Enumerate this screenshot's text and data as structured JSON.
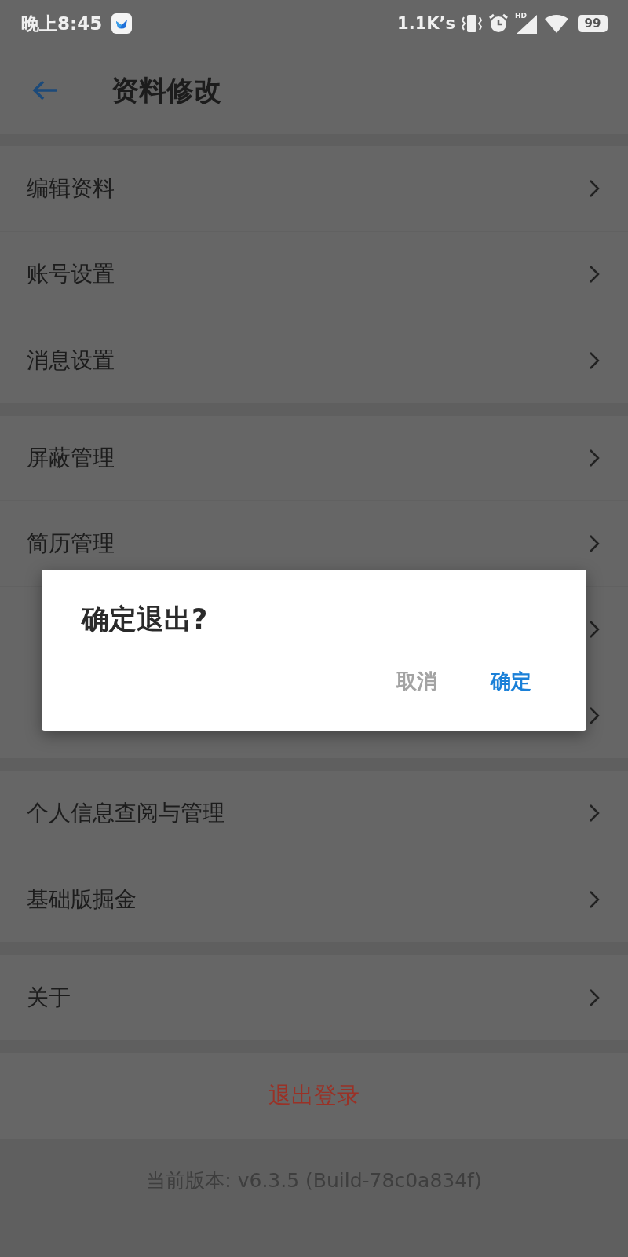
{
  "status_bar": {
    "time": "晚上8:45",
    "net_speed": "1.1K’s",
    "signal_label": "HD",
    "battery": "99"
  },
  "header": {
    "title": "资料修改"
  },
  "groups": [
    {
      "items": [
        {
          "kind": "labeled",
          "label": "编辑资料"
        },
        {
          "kind": "labeled",
          "label": "账号设置"
        },
        {
          "kind": "labeled",
          "label": "消息设置"
        }
      ]
    },
    {
      "items": [
        {
          "kind": "labeled",
          "label": "屏蔽管理"
        },
        {
          "kind": "labeled",
          "label": "简历管理"
        },
        {
          "kind": "covered"
        },
        {
          "kind": "covered"
        }
      ]
    },
    {
      "items": [
        {
          "kind": "labeled",
          "label": "个人信息查阅与管理"
        },
        {
          "kind": "labeled",
          "label": "基础版掘金"
        }
      ]
    },
    {
      "items": [
        {
          "kind": "labeled",
          "label": "关于"
        }
      ]
    }
  ],
  "logout": {
    "label": "退出登录"
  },
  "version": "当前版本: v6.3.5 (Build-78c0a834f)",
  "dialog": {
    "title": "确定退出?",
    "buttons": [
      {
        "label": "取消",
        "kind": "cancel"
      },
      {
        "label": "确定",
        "kind": "confirm"
      }
    ]
  }
}
